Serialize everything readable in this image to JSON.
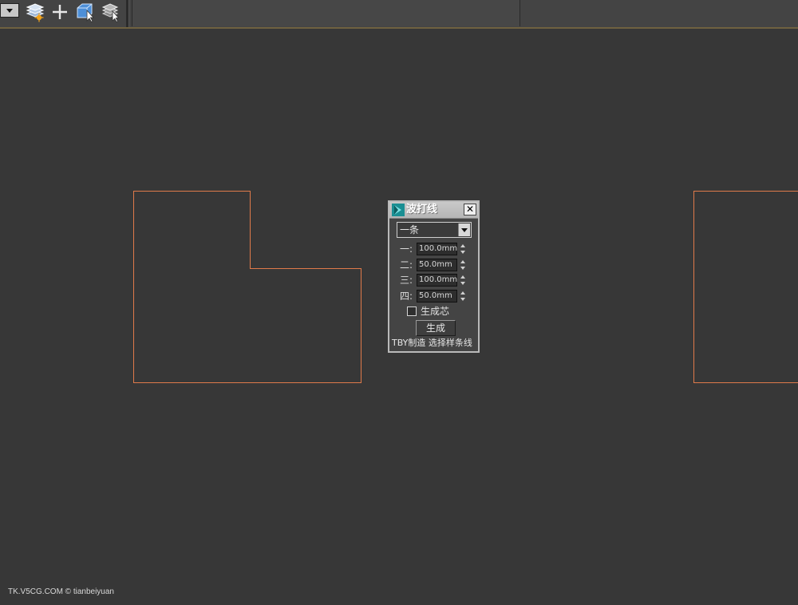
{
  "toolbar": {
    "icons": [
      "dropdown-toggle",
      "layer-manager-icon",
      "plus-icon",
      "select-object-icon",
      "layer-select-icon"
    ]
  },
  "viewport": {
    "shape_color": "#e07a4a",
    "background": "#373737"
  },
  "dialog": {
    "title": "波打线",
    "close_label": "✕",
    "select_value": "一条",
    "fields": [
      {
        "label": "一:",
        "value": "100.0mm"
      },
      {
        "label": "二:",
        "value": "50.0mm"
      },
      {
        "label": "三:",
        "value": "100.0mm"
      },
      {
        "label": "四:",
        "value": "50.0mm"
      }
    ],
    "checkbox_label": "生成芯",
    "checkbox_checked": false,
    "button_label": "生成",
    "footer_text": "TBY制造 选择样条线"
  },
  "watermark": "TK.V5CG.COM © tianbeiyuan"
}
